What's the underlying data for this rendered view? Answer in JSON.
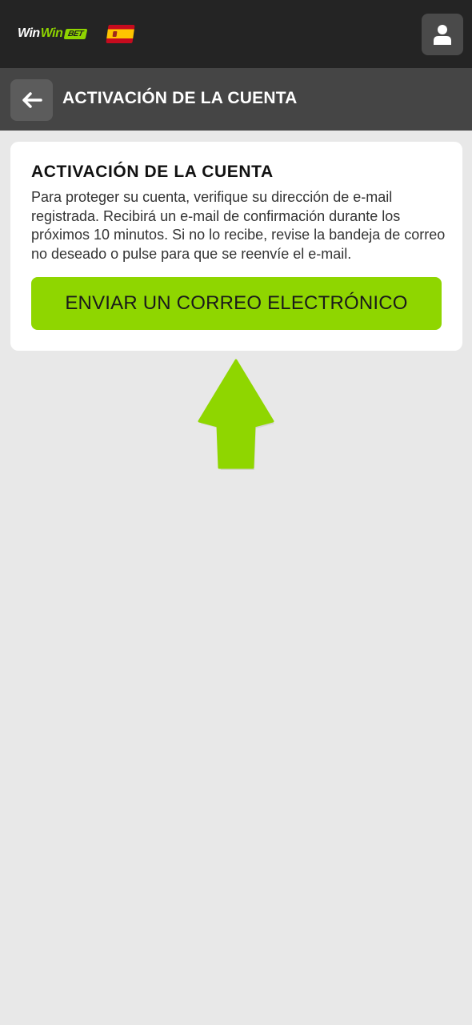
{
  "header": {
    "logo": {
      "word1": "Win",
      "word2": "Win",
      "badge": "BET"
    },
    "language_flag_icon": "spain-flag-icon",
    "user_icon": "user-icon"
  },
  "titlebar": {
    "back_icon": "arrow-left-icon",
    "title": "ACTIVACIÓN DE LA CUENTA"
  },
  "card": {
    "title": "ACTIVACIÓN DE LA CUENTA",
    "text": "Para proteger su cuenta, verifique su dirección de e-mail registrada. Recibirá un e-mail de confirmación durante los próximos 10 minutos. Si no lo recibe, revise la bandeja de correo no deseado o pulse para que se reenvíe el e-mail.",
    "button_label": "ENVIAR UN CORREO ELECTRÓNICO"
  },
  "annotation": {
    "icon": "arrow-up-icon"
  },
  "colors": {
    "accent": "#8fd600",
    "header_bg": "#242424",
    "titlebar_bg": "#454545",
    "page_bg": "#e8e8e8"
  }
}
